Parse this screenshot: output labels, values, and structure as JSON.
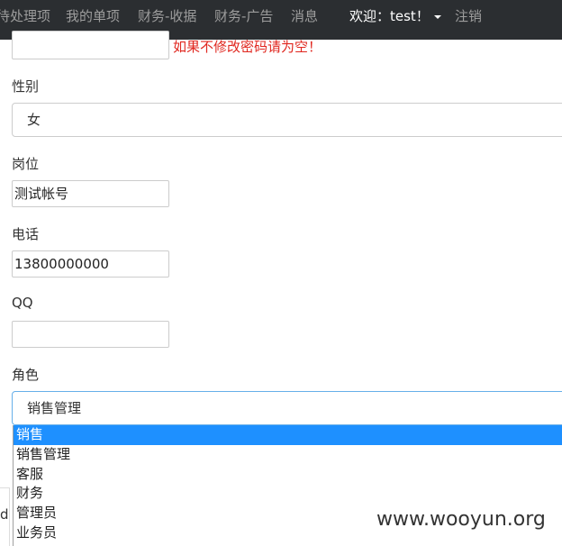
{
  "navbar": {
    "items": [
      {
        "label": "待处理项"
      },
      {
        "label": "我的单项"
      },
      {
        "label": "财务-收据"
      },
      {
        "label": "财务-广告"
      },
      {
        "label": "消息"
      }
    ],
    "welcome": "欢迎：test！",
    "logout": "注销"
  },
  "form": {
    "password_hint": "如果不修改密码请为空！",
    "gender_label": "性别",
    "gender_value": "女",
    "position_label": "岗位",
    "position_value": "测试帐号",
    "phone_label": "电话",
    "phone_value": "13800000000",
    "qq_label": "QQ",
    "qq_value": "",
    "role_label": "角色",
    "role_value": "销售管理",
    "role_options": [
      "销售",
      "销售管理",
      "客服",
      "财务",
      "管理员",
      "业务员"
    ]
  },
  "partial_left_text": "d",
  "watermark": "www.wooyun.org",
  "colors": {
    "navbar_bg": "#2b2e31",
    "hint": "#e0271f",
    "option_highlight": "#1e90ff"
  }
}
